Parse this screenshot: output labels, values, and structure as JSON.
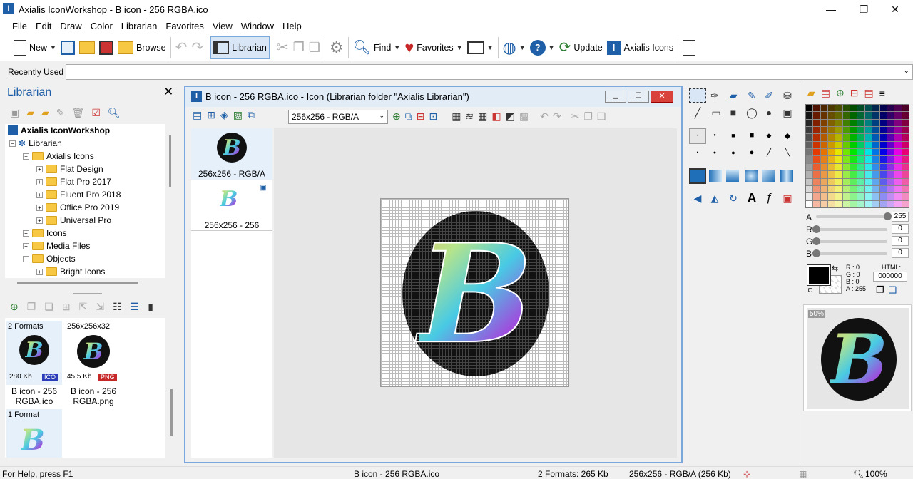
{
  "window": {
    "title": "Axialis IconWorkshop - B icon - 256 RGBA.ico",
    "minimize": "—",
    "restore": "❐",
    "close": "✕"
  },
  "menu": [
    "File",
    "Edit",
    "Draw",
    "Color",
    "Librarian",
    "Favorites",
    "View",
    "Window",
    "Help"
  ],
  "toolbar": {
    "new": "New",
    "browse": "Browse",
    "librarian": "Librarian",
    "find": "Find",
    "favorites": "Favorites",
    "update": "Update",
    "axialis_icons": "Axialis Icons"
  },
  "recent": {
    "label": "Recently Used",
    "value": ""
  },
  "librarian": {
    "title": "Librarian",
    "tree": [
      {
        "label": "Axialis IconWorkshop",
        "level": 0,
        "bold": true
      },
      {
        "label": "Librarian",
        "level": 1
      },
      {
        "label": "Axialis Icons",
        "level": 2
      },
      {
        "label": "Flat Design",
        "level": 3
      },
      {
        "label": "Flat Pro 2017",
        "level": 3
      },
      {
        "label": "Fluent Pro 2018",
        "level": 3
      },
      {
        "label": "Office Pro 2019",
        "level": 3
      },
      {
        "label": "Universal Pro",
        "level": 3
      },
      {
        "label": "Icons",
        "level": 2
      },
      {
        "label": "Media Files",
        "level": 2
      },
      {
        "label": "Objects",
        "level": 2
      },
      {
        "label": "Bright Icons",
        "level": 3
      }
    ],
    "cards": [
      {
        "header": "2 Formats",
        "size": "280 Kb",
        "badge": "ICO",
        "name": "B icon - 256 RGBA.ico"
      },
      {
        "header": "256x256x32",
        "size": "45.5 Kb",
        "badge": "PNG",
        "name": "B icon - 256 RGBA.png"
      },
      {
        "header": "1 Format"
      }
    ]
  },
  "document": {
    "title": "B icon - 256 RGBA.ico - Icon (Librarian folder \"Axialis Librarian\")",
    "format_select": "256x256 - RGB/A",
    "formats": [
      {
        "label": "256x256 - RGB/A"
      },
      {
        "label": "256x256 - 256"
      }
    ],
    "letter": "B"
  },
  "color": {
    "channels": [
      {
        "name": "A",
        "value": "255",
        "level": 1
      },
      {
        "name": "R",
        "value": "0",
        "level": 0
      },
      {
        "name": "G",
        "value": "0",
        "level": 0
      },
      {
        "name": "B",
        "value": "0",
        "level": 0
      }
    ],
    "readout": {
      "r": "R :  0",
      "g": "G :  0",
      "b": "B :  0",
      "a": "A : 255"
    },
    "html_label": "HTML:",
    "html_value": "000000",
    "current": "#000000"
  },
  "preview": {
    "zoom": "50%"
  },
  "status": {
    "help": "For Help, press F1",
    "file": "B icon - 256 RGBA.ico",
    "formats": "2 Formats: 265 Kb",
    "current": "256x256 - RGB/A (256 Kb)",
    "zoom": "100%"
  }
}
